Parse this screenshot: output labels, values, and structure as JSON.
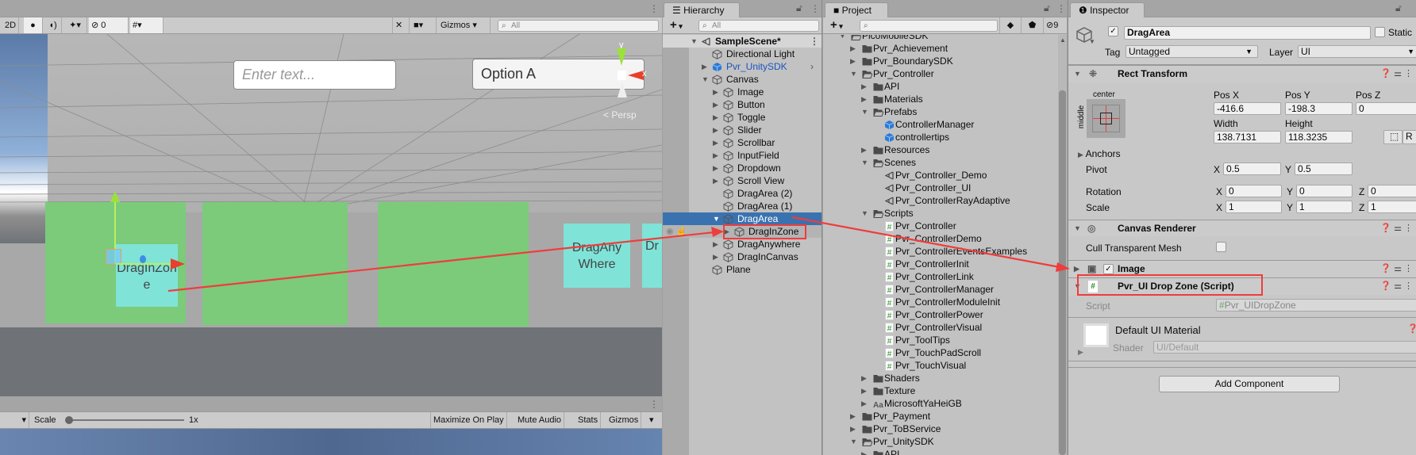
{
  "scene": {
    "toolbar": {
      "mode2d": "2D",
      "hidden_count": "0",
      "gizmos": "Gizmos",
      "search_placeholder": "All"
    },
    "input_placeholder": "Enter text...",
    "dropdown_label": "Option A",
    "persp_label": "Persp",
    "gizmo_axes": {
      "y": "y",
      "x": "x"
    },
    "drag_in_zone_label": "DragInZone",
    "drag_anywhere_label": "DragAnyWhere",
    "drag_partial_label": "Dr a",
    "colors": {
      "green_area": "#7bcb7b",
      "cyan_item": "#7fe3d8",
      "sky": "#5b7aa8",
      "ground": "#6f7378"
    }
  },
  "game": {
    "toolbar": {
      "scale_label": "Scale",
      "scale_value": "1x",
      "scale_fraction": 0.0,
      "maximize": "Maximize On Play",
      "mute": "Mute Audio",
      "stats": "Stats",
      "gizmos": "Gizmos"
    }
  },
  "hierarchy": {
    "tab": "Hierarchy",
    "search_placeholder": "All",
    "items": [
      {
        "label": "SampleScene*",
        "depth": 0,
        "arrow": "open",
        "icon": "scene",
        "style": "scene"
      },
      {
        "label": "Directional Light",
        "depth": 1,
        "arrow": "",
        "icon": "gameobject"
      },
      {
        "label": "Pvr_UnitySDK",
        "depth": 1,
        "arrow": "closed",
        "icon": "prefab",
        "style": "prefab"
      },
      {
        "label": "Canvas",
        "depth": 1,
        "arrow": "open",
        "icon": "gameobject"
      },
      {
        "label": "Image",
        "depth": 2,
        "arrow": "closed",
        "icon": "gameobject"
      },
      {
        "label": "Button",
        "depth": 2,
        "arrow": "closed",
        "icon": "gameobject"
      },
      {
        "label": "Toggle",
        "depth": 2,
        "arrow": "closed",
        "icon": "gameobject"
      },
      {
        "label": "Slider",
        "depth": 2,
        "arrow": "closed",
        "icon": "gameobject"
      },
      {
        "label": "Scrollbar",
        "depth": 2,
        "arrow": "closed",
        "icon": "gameobject"
      },
      {
        "label": "InputField",
        "depth": 2,
        "arrow": "closed",
        "icon": "gameobject"
      },
      {
        "label": "Dropdown",
        "depth": 2,
        "arrow": "closed",
        "icon": "gameobject"
      },
      {
        "label": "Scroll View",
        "depth": 2,
        "arrow": "closed",
        "icon": "gameobject"
      },
      {
        "label": "DragArea (2)",
        "depth": 2,
        "arrow": "",
        "icon": "gameobject"
      },
      {
        "label": "DragArea (1)",
        "depth": 2,
        "arrow": "",
        "icon": "gameobject"
      },
      {
        "label": "DragArea",
        "depth": 2,
        "arrow": "open",
        "icon": "gameobject",
        "style": "selected"
      },
      {
        "label": "DragInZone",
        "depth": 3,
        "arrow": "closed",
        "icon": "gameobject",
        "style": "hover"
      },
      {
        "label": "DragAnywhere",
        "depth": 2,
        "arrow": "closed",
        "icon": "gameobject"
      },
      {
        "label": "DragInCanvas",
        "depth": 2,
        "arrow": "closed",
        "icon": "gameobject"
      },
      {
        "label": "Plane",
        "depth": 1,
        "arrow": "",
        "icon": "gameobject"
      }
    ]
  },
  "project": {
    "tab": "Project",
    "hidden_count": "9",
    "items": [
      {
        "label": "PicoMobileSDK",
        "depth": 0,
        "arrow": "open",
        "icon": "folder-open"
      },
      {
        "label": "Pvr_Achievement",
        "depth": 1,
        "arrow": "closed",
        "icon": "folder"
      },
      {
        "label": "Pvr_BoundarySDK",
        "depth": 1,
        "arrow": "closed",
        "icon": "folder"
      },
      {
        "label": "Pvr_Controller",
        "depth": 1,
        "arrow": "open",
        "icon": "folder-open"
      },
      {
        "label": "API",
        "depth": 2,
        "arrow": "closed",
        "icon": "folder"
      },
      {
        "label": "Materials",
        "depth": 2,
        "arrow": "closed",
        "icon": "folder"
      },
      {
        "label": "Prefabs",
        "depth": 2,
        "arrow": "open",
        "icon": "folder-open"
      },
      {
        "label": "ControllerManager",
        "depth": 3,
        "arrow": "",
        "icon": "prefab"
      },
      {
        "label": "controllertips",
        "depth": 3,
        "arrow": "",
        "icon": "prefab"
      },
      {
        "label": "Resources",
        "depth": 2,
        "arrow": "closed",
        "icon": "folder"
      },
      {
        "label": "Scenes",
        "depth": 2,
        "arrow": "open",
        "icon": "folder-open"
      },
      {
        "label": "Pvr_Controller_Demo",
        "depth": 3,
        "arrow": "",
        "icon": "scene"
      },
      {
        "label": "Pvr_Controller_UI",
        "depth": 3,
        "arrow": "",
        "icon": "scene"
      },
      {
        "label": "Pvr_ControllerRayAdaptive",
        "depth": 3,
        "arrow": "",
        "icon": "scene"
      },
      {
        "label": "Scripts",
        "depth": 2,
        "arrow": "open",
        "icon": "folder-open"
      },
      {
        "label": "Pvr_Controller",
        "depth": 3,
        "arrow": "",
        "icon": "script"
      },
      {
        "label": "Pvr_ControllerDemo",
        "depth": 3,
        "arrow": "",
        "icon": "script"
      },
      {
        "label": "Pvr_ControllerEventsExamples",
        "depth": 3,
        "arrow": "",
        "icon": "script"
      },
      {
        "label": "Pvr_ControllerInit",
        "depth": 3,
        "arrow": "",
        "icon": "script"
      },
      {
        "label": "Pvr_ControllerLink",
        "depth": 3,
        "arrow": "",
        "icon": "script"
      },
      {
        "label": "Pvr_ControllerManager",
        "depth": 3,
        "arrow": "",
        "icon": "script"
      },
      {
        "label": "Pvr_ControllerModuleInit",
        "depth": 3,
        "arrow": "",
        "icon": "script"
      },
      {
        "label": "Pvr_ControllerPower",
        "depth": 3,
        "arrow": "",
        "icon": "script"
      },
      {
        "label": "Pvr_ControllerVisual",
        "depth": 3,
        "arrow": "",
        "icon": "script"
      },
      {
        "label": "Pvr_ToolTips",
        "depth": 3,
        "arrow": "",
        "icon": "script"
      },
      {
        "label": "Pvr_TouchPadScroll",
        "depth": 3,
        "arrow": "",
        "icon": "script"
      },
      {
        "label": "Pvr_TouchVisual",
        "depth": 3,
        "arrow": "",
        "icon": "script"
      },
      {
        "label": "Shaders",
        "depth": 2,
        "arrow": "closed",
        "icon": "folder"
      },
      {
        "label": "Texture",
        "depth": 2,
        "arrow": "closed",
        "icon": "folder"
      },
      {
        "label": "MicrosoftYaHeiGB",
        "depth": 2,
        "arrow": "closed",
        "icon": "font"
      },
      {
        "label": "Pvr_Payment",
        "depth": 1,
        "arrow": "closed",
        "icon": "folder"
      },
      {
        "label": "Pvr_ToBService",
        "depth": 1,
        "arrow": "closed",
        "icon": "folder"
      },
      {
        "label": "Pvr_UnitySDK",
        "depth": 1,
        "arrow": "open",
        "icon": "folder-open"
      },
      {
        "label": "API",
        "depth": 2,
        "arrow": "closed",
        "icon": "folder"
      }
    ]
  },
  "inspector": {
    "tab": "Inspector",
    "object_name": "DragArea",
    "active": true,
    "static_label": "Static",
    "tag_label": "Tag",
    "tag_value": "Untagged",
    "layer_label": "Layer",
    "layer_value": "UI",
    "rect_transform": {
      "title": "Rect Transform",
      "anchor_h": "center",
      "anchor_v": "middle",
      "pos_x_label": "Pos X",
      "pos_y_label": "Pos Y",
      "pos_z_label": "Pos Z",
      "pos_x": "-416.6",
      "pos_y": "-198.3",
      "pos_z": "0",
      "width_label": "Width",
      "height_label": "Height",
      "width": "138.7131",
      "height": "118.3235",
      "raw_button": "R",
      "anchors_label": "Anchors",
      "pivot_label": "Pivot",
      "pivot_x": "0.5",
      "pivot_y": "0.5",
      "rotation_label": "Rotation",
      "rot_x": "0",
      "rot_y": "0",
      "rot_z": "0",
      "scale_label": "Scale",
      "scale_x": "1",
      "scale_y": "1",
      "scale_z": "1",
      "x": "X",
      "y": "Y",
      "z": "Z"
    },
    "canvas_renderer": {
      "title": "Canvas Renderer",
      "cull_label": "Cull Transparent Mesh",
      "cull": false
    },
    "image": {
      "title": "Image",
      "enabled": true
    },
    "script_component": {
      "title": "Pvr_UI Drop Zone (Script)",
      "script_label": "Script",
      "script_value": "Pvr_UIDropZone"
    },
    "material": {
      "title": "Default UI Material",
      "shader_label": "Shader",
      "shader_value": "UI/Default"
    },
    "add_component": "Add Component"
  },
  "annotation_color": "#f03c3c",
  "selection_color": "#3a72b0"
}
